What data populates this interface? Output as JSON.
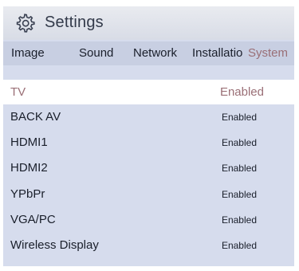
{
  "header": {
    "icon": "gear-icon",
    "title": "Settings"
  },
  "tabs": [
    {
      "label": "Image",
      "active": false
    },
    {
      "label": "Sound",
      "active": false
    },
    {
      "label": "Network",
      "active": false
    },
    {
      "label": "Installatio",
      "active": false
    },
    {
      "label": "System",
      "active": true
    }
  ],
  "rows": [
    {
      "label": "TV",
      "value": "Enabled",
      "selected": true
    },
    {
      "label": "BACK AV",
      "value": "Enabled",
      "selected": false
    },
    {
      "label": "HDMI1",
      "value": "Enabled",
      "selected": false
    },
    {
      "label": "HDMI2",
      "value": "Enabled",
      "selected": false
    },
    {
      "label": "YPbPr",
      "value": "Enabled",
      "selected": false
    },
    {
      "label": "VGA/PC",
      "value": "Enabled",
      "selected": false
    },
    {
      "label": "Wireless Display",
      "value": "Enabled",
      "selected": false
    }
  ],
  "colors": {
    "panel": "#d6dced",
    "active_text": "#9a6f76",
    "text": "#1a1f2b"
  }
}
